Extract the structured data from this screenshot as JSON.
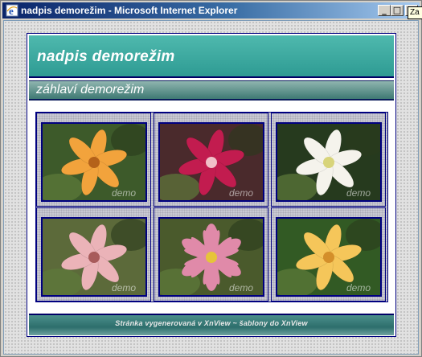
{
  "window": {
    "title": "nadpis demorežim - Microsoft Internet Explorer",
    "controls": {
      "minimize": "_",
      "maximize": "□",
      "close": "×"
    }
  },
  "tooltip": "Za",
  "page": {
    "site_title": "nadpis demorežim",
    "subheader": "záhlaví demorežim",
    "footer": "Stránka vygenerovaná v XnView  ~  šablony do XnView"
  },
  "gallery": {
    "watermark": "demo",
    "photos": [
      {
        "name": "orange-lily",
        "colors": {
          "petal": "#f2a33c",
          "bg": "#3d5a2a",
          "center": "#b4621a"
        }
      },
      {
        "name": "magenta-lily",
        "colors": {
          "petal": "#c21c4f",
          "bg": "#4a2a2c",
          "center": "#f1c0c8"
        }
      },
      {
        "name": "white-lily",
        "colors": {
          "petal": "#f5f3ec",
          "bg": "#263a1e",
          "center": "#d8d47a"
        }
      },
      {
        "name": "pink-lily",
        "colors": {
          "petal": "#ebb3b8",
          "bg": "#5c6a3a",
          "center": "#a85b5b"
        }
      },
      {
        "name": "pink-gazania",
        "colors": {
          "petal": "#e08aa9",
          "bg": "#4a5a2c",
          "center": "#e6c43a"
        }
      },
      {
        "name": "yellow-lilies",
        "colors": {
          "petal": "#f5c65a",
          "bg": "#325a24",
          "center": "#d48f2a"
        }
      }
    ]
  }
}
